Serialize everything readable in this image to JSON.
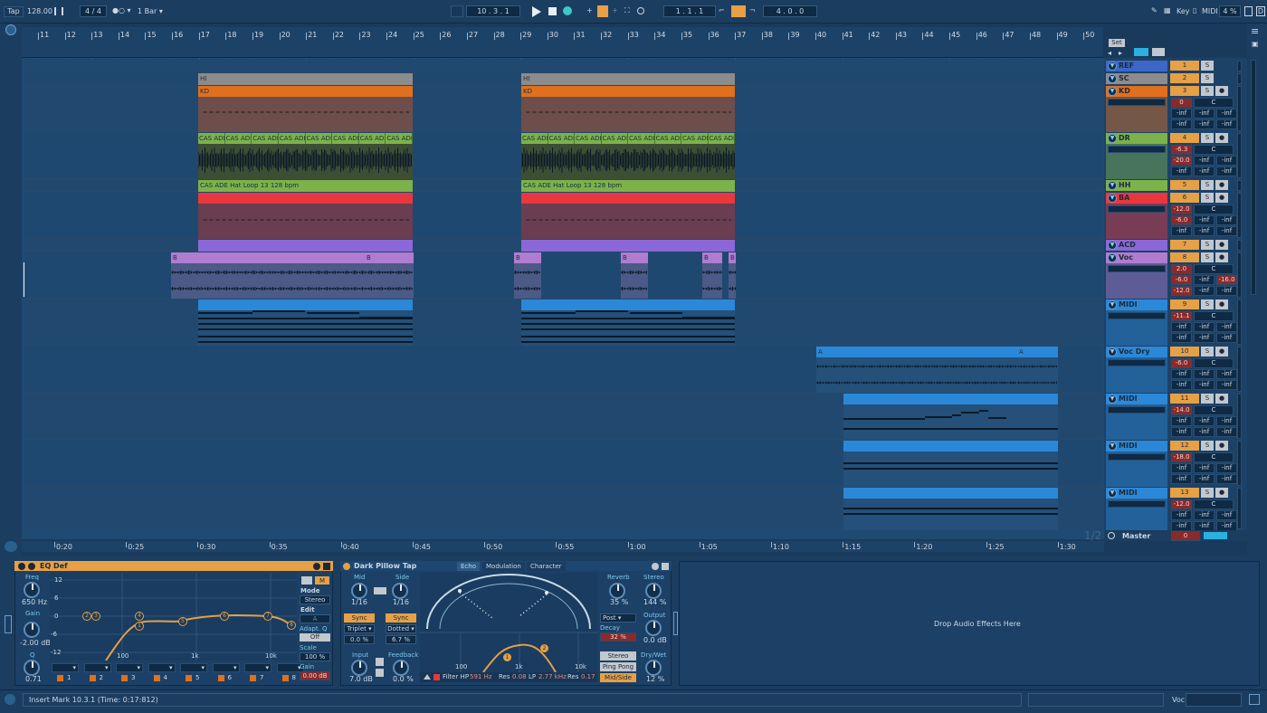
{
  "transport": {
    "tap": "Tap",
    "tempo": "128.00",
    "time_sig": "4 / 4",
    "quantize": "1 Bar",
    "position": "10 .   3 .   1",
    "loop_start": "1 .   1 .   1",
    "loop_length": "4 .   0 .   0",
    "key_label": "Key",
    "midi_label": "MIDI",
    "cpu": "4 %",
    "d_label": "D"
  },
  "ruler": {
    "bars": [
      "11",
      "12",
      "13",
      "14",
      "15",
      "16",
      "17",
      "18",
      "19",
      "20",
      "21",
      "22",
      "23",
      "24",
      "25",
      "26",
      "27",
      "28",
      "29",
      "30",
      "31",
      "32",
      "33",
      "34",
      "35",
      "36",
      "37",
      "38",
      "39",
      "40",
      "41",
      "42",
      "43",
      "44",
      "45",
      "46",
      "47",
      "48",
      "49",
      "50"
    ],
    "set_label": "Set",
    "time_labels": [
      "0:20",
      "0:25",
      "0:30",
      "0:35",
      "0:40",
      "0:45",
      "0:50",
      "0:55",
      "1:00",
      "1:05",
      "1:10",
      "1:15",
      "1:20",
      "1:25",
      "1:30"
    ],
    "page": "1/2"
  },
  "tracks": [
    {
      "name": "REF",
      "num": "1",
      "color": "#3b68c8",
      "vol": "",
      "pan": ""
    },
    {
      "name": "SC",
      "num": "2",
      "color": "#8c8c8c"
    },
    {
      "name": "KD",
      "num": "3",
      "color": "#e0701e",
      "vol": "0",
      "pan": "C",
      "a": "-inf",
      "b": "-inf",
      "c": "-inf",
      "d": "-inf",
      "e": "-inf",
      "f": "-inf"
    },
    {
      "name": "DR",
      "num": "4",
      "color": "#7cb24a",
      "vol": "-6.3",
      "pan": "C",
      "a": "-20.0",
      "b": "-inf",
      "c": "-inf",
      "d": "-inf",
      "e": "-inf",
      "f": "-inf"
    },
    {
      "name": "HH",
      "num": "5",
      "color": "#7cb24a"
    },
    {
      "name": "BA",
      "num": "6",
      "color": "#e8383e",
      "vol": "-12.0",
      "pan": "C",
      "a": "-6.0",
      "b": "-inf",
      "c": "-inf",
      "d": "-inf",
      "e": "-inf",
      "f": "-inf"
    },
    {
      "name": "ACD",
      "num": "7",
      "color": "#8a68d8"
    },
    {
      "name": "Voc",
      "num": "8",
      "color": "#b07cd0",
      "vol": "2.0",
      "pan": "C",
      "a": "-6.0",
      "b": "-inf",
      "c": "-16.0",
      "d": "-12.0",
      "e": "-inf",
      "f": "-inf"
    },
    {
      "name": "MIDI",
      "num": "9",
      "color": "#2b88d8",
      "vol": "-11.1",
      "pan": "C",
      "a": "-inf",
      "b": "-inf",
      "c": "-inf",
      "d": "-inf",
      "e": "-inf",
      "f": "-inf"
    },
    {
      "name": "Voc Dry",
      "num": "10",
      "color": "#2b88d8",
      "vol": "-6.0",
      "pan": "C",
      "a": "-inf",
      "b": "-inf",
      "c": "-inf",
      "d": "-inf",
      "e": "-inf",
      "f": "-inf"
    },
    {
      "name": "MIDI",
      "num": "11",
      "color": "#2b88d8",
      "vol": "-14.0",
      "pan": "C",
      "a": "-inf",
      "b": "-inf",
      "c": "-inf",
      "d": "-inf",
      "e": "-inf",
      "f": "-inf"
    },
    {
      "name": "MIDI",
      "num": "12",
      "color": "#2b88d8",
      "vol": "-18.0",
      "pan": "C",
      "a": "-inf",
      "b": "-inf",
      "c": "-inf",
      "d": "-inf",
      "e": "-inf",
      "f": "-inf"
    },
    {
      "name": "MIDI",
      "num": "13",
      "color": "#2b88d8",
      "vol": "-12.0",
      "pan": "C",
      "a": "-inf",
      "b": "-inf",
      "c": "-inf",
      "d": "-inf",
      "e": "-inf",
      "f": "-inf"
    }
  ],
  "master": {
    "name": "Master",
    "vol": "0"
  },
  "clips": {
    "hi": "HI",
    "kd": "KD",
    "cas": "CAS ADE",
    "hat": "CAS ADE Hat Loop 13 128 bpm",
    "b": "B",
    "a": "A"
  },
  "solo": "S",
  "eq": {
    "title": "EQ Def",
    "freq_label": "Freq",
    "freq": "650 Hz",
    "gain_label": "Gain",
    "gain": "-2.00 dB",
    "q_label": "Q",
    "q": "0.71",
    "y_ticks": [
      "12",
      "6",
      "0",
      "-6",
      "-12"
    ],
    "x_ticks": [
      "100",
      "1k",
      "10k"
    ],
    "mode_label": "Mode",
    "mode": "Stereo",
    "edit_label": "Edit",
    "edit_value": "A",
    "adapt_label": "Adapt. Q",
    "adapt": "Off",
    "scale_label": "Scale",
    "scale": "100 %",
    "out_gain_label": "Gain",
    "out_gain": "0.00 dB",
    "bands": [
      "1",
      "2",
      "3",
      "4",
      "5",
      "6",
      "7",
      "8"
    ],
    "points": [
      "2",
      "3",
      "4",
      "1",
      "5",
      "6",
      "7",
      "8"
    ]
  },
  "echo": {
    "title": "Dark Pillow Tap",
    "tabs": [
      "Echo",
      "Modulation",
      "Character"
    ],
    "mid_label": "Mid",
    "side_label": "Side",
    "mid_val": "1/16",
    "side_val": "1/16",
    "sync": "Sync",
    "triplet": "Triplet",
    "dotted": "Dotted",
    "offset_l": "0.0 %",
    "offset_r": "6.7 %",
    "input_label": "Input",
    "input": "7.0 dB",
    "feedback_label": "Feedback",
    "feedback": "0.0 %",
    "filter_label": "Filter HP",
    "hp": "591 Hz",
    "res_label": "Res",
    "res1": "0.08",
    "lp_label": "LP",
    "lp": "2.77 kHz",
    "res2": "0.17",
    "x_ticks": [
      "100",
      "1k",
      "10k"
    ],
    "reverb_label": "Reverb",
    "reverb": "35 %",
    "stereo_label": "Stereo",
    "stereo": "144 %",
    "post": "Post",
    "decay_label": "Decay",
    "decay": "32 %",
    "output_label": "Output",
    "output": "0.0 dB",
    "mode_stereo": "Stereo",
    "ping_pong": "Ping Pong",
    "mid_side": "Mid/Side",
    "drywet_label": "Dry/Wet",
    "drywet": "12 %"
  },
  "drop": "Drop Audio Effects Here",
  "status": {
    "text": "Insert Mark 10.3.1 (Time: 0:17:812)",
    "track": "Voc"
  }
}
